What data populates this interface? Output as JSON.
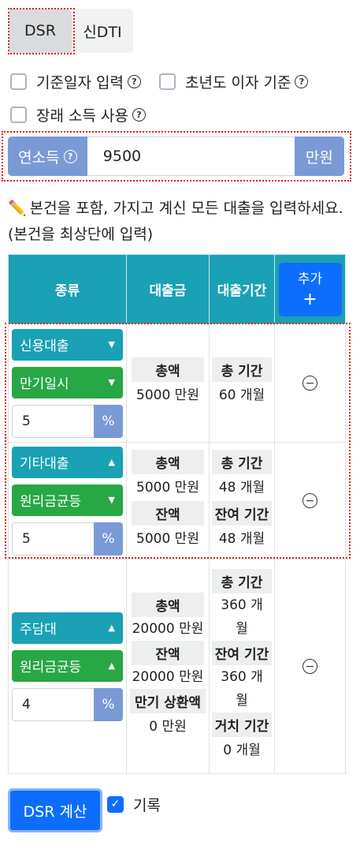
{
  "tabs": [
    {
      "label": "DSR",
      "active": true
    },
    {
      "label": "신DTI",
      "active": false
    }
  ],
  "options": {
    "base_date": {
      "label": "기준일자 입력",
      "checked": false
    },
    "year_interest": {
      "label": "초년도 이자 기준",
      "checked": false
    },
    "future_income": {
      "label": "장래 소득 사용",
      "checked": false
    }
  },
  "income": {
    "label": "연소득",
    "value": "9500",
    "unit": "만원"
  },
  "note": "본건을 포함, 가지고 계신 모든 대출을 입력하세요. (본건을 최상단에 입력)",
  "table": {
    "headers": {
      "type": "종류",
      "amount": "대출금",
      "period": "대출기간",
      "add": "추가",
      "add_symbol": "+"
    },
    "rows": [
      {
        "loan_type": "신용대출",
        "repay_type": "만기일시",
        "rate": "5",
        "rate_unit": "%",
        "total_label": "총액",
        "total_value": "5000 만원",
        "period_label": "총 기간",
        "period_value": "60 개월"
      },
      {
        "loan_type": "기타대출",
        "repay_type": "원리금균등",
        "rate": "5",
        "rate_unit": "%",
        "total_label": "총액",
        "total_value": "5000 만원",
        "period_label": "총 기간",
        "period_value": "48 개월",
        "balance_label": "잔액",
        "balance_value": "5000 만원",
        "remain_label": "잔여 기간",
        "remain_value": "48 개월"
      },
      {
        "loan_type": "주담대",
        "repay_type": "원리금균등",
        "rate": "4",
        "rate_unit": "%",
        "total_label": "총액",
        "total_value": "20000 만원",
        "period_label": "총 기간",
        "period_value": "360 개월",
        "balance_label": "잔액",
        "balance_value": "20000 만원",
        "remain_label": "잔여 기간",
        "remain_value": "360 개월",
        "maturity_label": "만기 상환액",
        "maturity_value": "0 만원",
        "grace_label": "거치 기간",
        "grace_value": "0 개월"
      }
    ]
  },
  "calc_button": "DSR 계산",
  "record": {
    "label": "기록",
    "checked": true
  },
  "icons": {
    "help": "question-circle-icon",
    "remove": "minus-circle-icon",
    "pencil": "pencil-icon"
  },
  "colors": {
    "primary": "#0d6efd",
    "teal": "#1aa1b5",
    "green": "#28a745",
    "addon": "#7a9ad6",
    "highlight": "#e11919"
  }
}
